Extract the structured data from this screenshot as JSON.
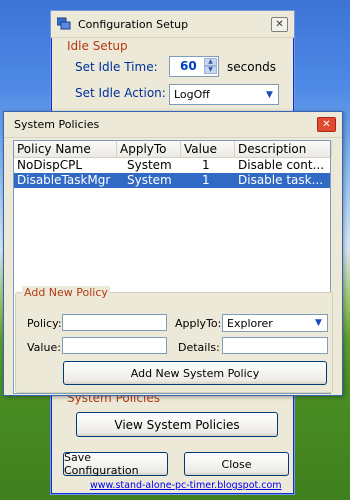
{
  "main_window": {
    "title": "Configuration Setup",
    "idle_setup_title": "Idle Setup",
    "set_idle_time_label": "Set Idle Time:",
    "idle_time_value": "60",
    "seconds_label": "seconds",
    "set_idle_action_label": "Set Idle Action:",
    "idle_action_value": "LogOff",
    "system_policies_group_title": "System Policies",
    "view_policies_button": "View System Policies",
    "save_button": "Save Configuration",
    "close_button": "Close",
    "website_link": "www.stand-alone-pc-timer.blogspot.com"
  },
  "policies_window": {
    "title": "System Policies",
    "columns": [
      "Policy Name",
      "ApplyTo",
      "Value",
      "Description"
    ],
    "rows": [
      {
        "policy_name": "NoDispCPL",
        "apply_to": "System",
        "value": "1",
        "description": "Disable cont..."
      },
      {
        "policy_name": "DisableTaskMgr",
        "apply_to": "System",
        "value": "1",
        "description": "Disable task..."
      }
    ],
    "selected_row": 1,
    "add_new_policy_title": "Add New Policy",
    "policy_label": "Policy:",
    "policy_value": "",
    "apply_to_label": "ApplyTo:",
    "apply_to_value": "Explorer",
    "value_label": "Value:",
    "value_value": "",
    "details_label": "Details:",
    "details_value": "",
    "add_button": "Add New System Policy"
  },
  "colors": {
    "group_title": "#b53a14",
    "field_label": "#00309c",
    "selection": "#316ac5",
    "close_red": "#e14a2e"
  }
}
